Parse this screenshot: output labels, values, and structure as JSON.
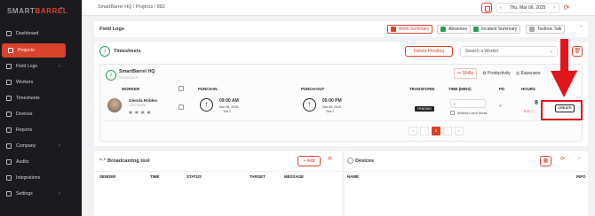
{
  "brand": {
    "part1": "SMART",
    "part2": "BARREL",
    "collapse": "⇤"
  },
  "sidebar": {
    "items": [
      {
        "label": "Dashboard",
        "chevron": ""
      },
      {
        "label": "Projects",
        "chevron": ""
      },
      {
        "label": "Field Logs",
        "chevron": "‹"
      },
      {
        "label": "Workers",
        "chevron": ""
      },
      {
        "label": "Timesheets",
        "chevron": ""
      },
      {
        "label": "Devices",
        "chevron": ""
      },
      {
        "label": "Reports",
        "chevron": ""
      },
      {
        "label": "Company",
        "chevron": "‹"
      },
      {
        "label": "Audits",
        "chevron": ""
      },
      {
        "label": "Integrations",
        "chevron": ""
      },
      {
        "label": "Settings",
        "chevron": "‹"
      }
    ],
    "active_index": 1
  },
  "topbar": {
    "breadcrumb": "SmartBarrel HQ / Projects / 882",
    "date": "Thu, Mar 06, 2025",
    "prev": "‹",
    "next": "›"
  },
  "field_logs": {
    "title": "Field Logs",
    "buttons": [
      "Work Summary",
      "Absentee",
      "Incident Summary",
      "Toolbox Talk"
    ]
  },
  "timesheets": {
    "title": "Timesheets",
    "badge": "1",
    "delete_label": "Delete Pending",
    "search_placeholder": "Search a Worker",
    "project": {
      "name": "SmartBarrel HQ",
      "sub": "SCHEDULE",
      "badge": "1",
      "tabs": [
        "Shifts",
        "Productivity",
        "Expenses"
      ]
    },
    "columns": [
      "WORKER",
      "PUNCH-IN",
      "PUNCH-OUT",
      "TRANSFORM",
      "TIME (MINS)",
      "PD",
      "HOURS"
    ],
    "row": {
      "worker": "Glenda Robles",
      "worker_id": "G00738498",
      "worker_icons": "▣ ▣ ▣ ▣",
      "punch_in_time": "09:00 AM",
      "punch_in_date": "Mar 06, 2025",
      "punch_in_tz": "Tert 2",
      "punch_out_time": "05:00 PM",
      "punch_out_date": "Mar 06, 2025",
      "punch_out_tz": "Tert 2",
      "transform": "PENDING",
      "time": "0",
      "lunch": "Worked Lunch Break",
      "pd": "⊳",
      "hours": "8",
      "hours_tag": "8.00 ⓘ",
      "create": "CREATE"
    },
    "pager": [
      "«",
      "‹",
      "1",
      "›",
      "»"
    ],
    "current_page": "1"
  },
  "broadcast": {
    "title": "Broadcasting tool",
    "icon": "“·”",
    "add": "+ Add",
    "columns": [
      "SENDER",
      "TIME",
      "STATUS",
      "TARGET",
      "MESSAGE"
    ]
  },
  "devices": {
    "title": "Devices",
    "columns": [
      "NAME",
      "INFO"
    ]
  },
  "colors": {
    "accent": "#d9432b",
    "sidebar": "#1b1b1f",
    "annotation": "#e3141b"
  }
}
